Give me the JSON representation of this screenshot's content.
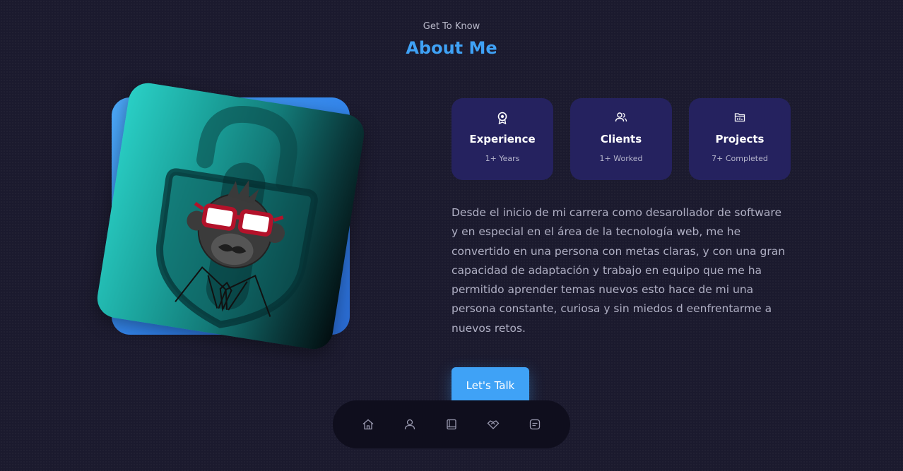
{
  "header": {
    "subtitle": "Get To Know",
    "title": "About Me"
  },
  "profile_image": {
    "description_icon": "padlock-monkey-glasses-icon"
  },
  "stats": [
    {
      "icon": "award-icon",
      "label": "Experience",
      "value": "1+ Years"
    },
    {
      "icon": "users-icon",
      "label": "Clients",
      "value": "1+ Worked"
    },
    {
      "icon": "folder-icon",
      "label": "Projects",
      "value": "7+ Completed"
    }
  ],
  "bio": "Desde el inicio de mi carrera como desarollador de software y en especial en el área de la tecnología web, me he convertido en una persona con metas claras, y con una gran capacidad de adaptación y trabajo en equipo que me ha permitido aprender temas nuevos esto hace de mi una persona constante, curiosa y sin miedos d eenfrentarme a nuevos retos.",
  "cta": {
    "label": "Let's Talk"
  },
  "dock": {
    "items": [
      {
        "icon": "home-icon"
      },
      {
        "icon": "user-icon"
      },
      {
        "icon": "book-icon"
      },
      {
        "icon": "handshake-icon"
      },
      {
        "icon": "message-icon"
      }
    ]
  },
  "colors": {
    "background": "#1b1a2e",
    "accent": "#3fa2f6",
    "card": "#25225f",
    "dock": "#0f0e1d"
  }
}
